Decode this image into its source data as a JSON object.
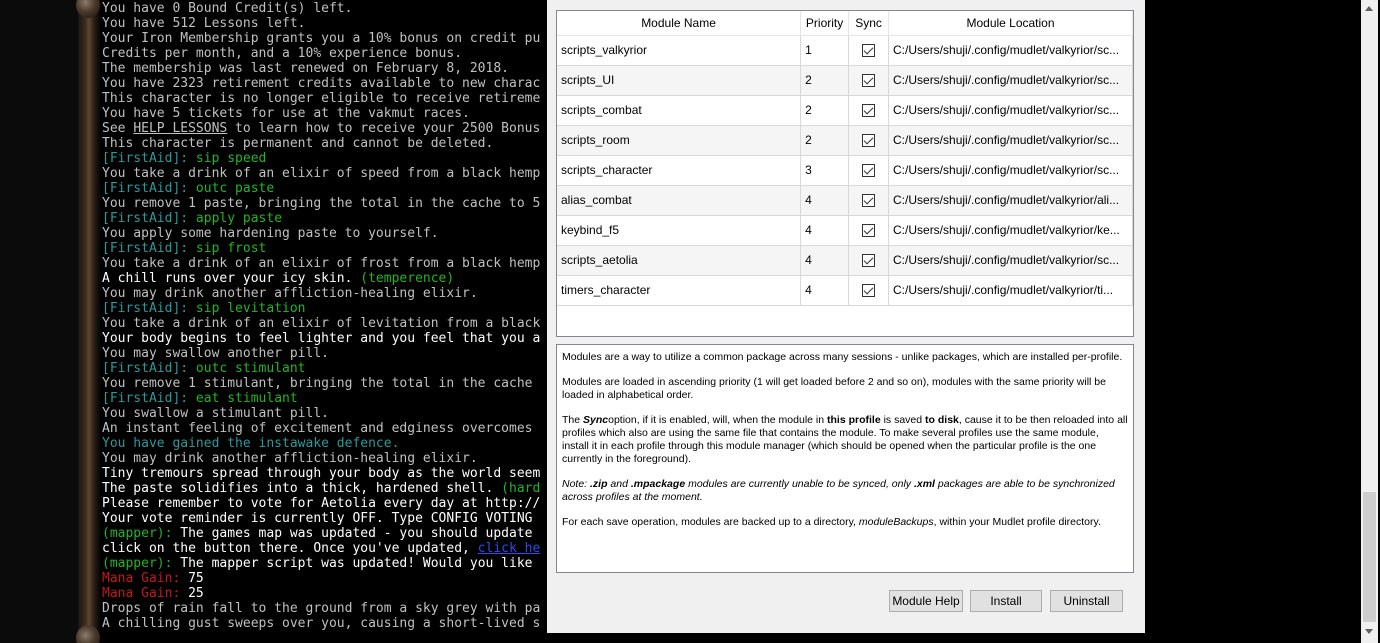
{
  "console": [
    [
      {
        "t": "You have 0 Bound Credit(s) left.",
        "c": "c-gray"
      }
    ],
    [
      {
        "t": "You have 512 Lessons left.",
        "c": "c-gray"
      }
    ],
    [
      {
        "t": "Your Iron Membership grants you a 10% bonus on credit pu",
        "c": "c-gray"
      }
    ],
    [
      {
        "t": "Credits per month, and a 10% experience bonus.",
        "c": "c-gray"
      }
    ],
    [
      {
        "t": "The membership was last renewed on February 8, 2018.",
        "c": "c-gray"
      }
    ],
    [
      {
        "t": "You have 2323 retirement credits available to new charac",
        "c": "c-gray"
      }
    ],
    [
      {
        "t": "This character is no longer eligible to receive retireme",
        "c": "c-gray"
      }
    ],
    [
      {
        "t": "You have 5 tickets for use at the vakmut races.",
        "c": "c-gray"
      }
    ],
    [
      {
        "t": "See ",
        "c": "c-gray"
      },
      {
        "t": "HELP LESSONS",
        "c": "c-gray u"
      },
      {
        "t": " to learn how to receive your 2500 Bonus",
        "c": "c-gray"
      }
    ],
    [
      {
        "t": "This character is permanent and cannot be deleted.",
        "c": "c-gray"
      }
    ],
    [
      {
        "t": "[FirstAid]: ",
        "c": "c-teal"
      },
      {
        "t": "sip speed",
        "c": "c-green"
      }
    ],
    [
      {
        "t": "You take a drink of an elixir of speed from a black hemp",
        "c": "c-gray"
      }
    ],
    [
      {
        "t": "[FirstAid]: ",
        "c": "c-teal"
      },
      {
        "t": "outc paste",
        "c": "c-green"
      }
    ],
    [
      {
        "t": "You remove 1 paste, bringing the total in the cache to 5",
        "c": "c-gray"
      }
    ],
    [
      {
        "t": "[FirstAid]: ",
        "c": "c-teal"
      },
      {
        "t": "apply paste",
        "c": "c-green"
      }
    ],
    [
      {
        "t": "You apply some hardening paste to yourself.",
        "c": "c-gray"
      }
    ],
    [
      {
        "t": "[FirstAid]: ",
        "c": "c-teal"
      },
      {
        "t": "sip frost",
        "c": "c-green"
      }
    ],
    [
      {
        "t": "You take a drink of an elixir of frost from a black hemp",
        "c": "c-gray"
      }
    ],
    [
      {
        "t": "A chill runs over your icy skin. ",
        "c": "c-white"
      },
      {
        "t": "(temperence)",
        "c": "c-green"
      }
    ],
    [
      {
        "t": "You may drink another affliction-healing elixir.",
        "c": "c-gray"
      }
    ],
    [
      {
        "t": "[FirstAid]: ",
        "c": "c-teal"
      },
      {
        "t": "sip levitation",
        "c": "c-green"
      }
    ],
    [
      {
        "t": "You take a drink of an elixir of levitation from a black",
        "c": "c-gray"
      }
    ],
    [
      {
        "t": "Your body begins to feel lighter and you feel that you a",
        "c": "c-white"
      }
    ],
    [
      {
        "t": "You may swallow another pill.",
        "c": "c-gray"
      }
    ],
    [
      {
        "t": "[FirstAid]: ",
        "c": "c-teal"
      },
      {
        "t": "outc stimulant",
        "c": "c-green"
      }
    ],
    [
      {
        "t": "You remove 1 stimulant, bringing the total in the cache",
        "c": "c-gray"
      }
    ],
    [
      {
        "t": "[FirstAid]: ",
        "c": "c-teal"
      },
      {
        "t": "eat stimulant",
        "c": "c-green"
      }
    ],
    [
      {
        "t": "You swallow a stimulant pill.",
        "c": "c-gray"
      }
    ],
    [
      {
        "t": "An instant feeling of excitement and edginess overcomes",
        "c": "c-gray"
      }
    ],
    [
      {
        "t": "You have gained the instawake defence.",
        "c": "c-teal"
      }
    ],
    [
      {
        "t": "You may drink another affliction-healing elixir.",
        "c": "c-gray"
      }
    ],
    [
      {
        "t": "Tiny tremours spread through your body as the world seem",
        "c": "c-white"
      }
    ],
    [
      {
        "t": "The paste solidifies into a thick, hardened shell. ",
        "c": "c-white"
      },
      {
        "t": "(hard",
        "c": "c-green"
      }
    ],
    [
      {
        "t": "Please remember to vote for Aetolia every day at http://",
        "c": "c-white"
      }
    ],
    [
      {
        "t": "Your vote reminder is currently OFF. Type CONFIG VOTING",
        "c": "c-white"
      }
    ],
    [
      {
        "t": "(mapper): ",
        "c": "c-green"
      },
      {
        "t": "The games map was updated - you should update",
        "c": "c-white"
      }
    ],
    [
      {
        "t": "click on the button there. Once you've updated, ",
        "c": "c-white"
      },
      {
        "t": "click he",
        "c": "c-link"
      }
    ],
    [
      {
        "t": "(mapper): ",
        "c": "c-green"
      },
      {
        "t": "The mapper script was updated! Would you like",
        "c": "c-white"
      }
    ],
    [
      {
        "t": "Mana Gain: ",
        "c": "c-red"
      },
      {
        "t": "75",
        "c": "c-white"
      }
    ],
    [
      {
        "t": "Mana Gain: ",
        "c": "c-red"
      },
      {
        "t": "25",
        "c": "c-white"
      }
    ],
    [
      {
        "t": "Drops of rain fall to the ground from a sky grey with pa",
        "c": "c-gray"
      }
    ],
    [
      {
        "t": "A chilling gust sweeps over you, causing a short-lived s",
        "c": "c-gray"
      }
    ]
  ],
  "module_table": {
    "headers": [
      "Module Name",
      "Priority",
      "Sync",
      "Module Location"
    ],
    "rows": [
      {
        "name": "scripts_valkyrior",
        "priority": "1",
        "location": "C:/Users/shuji/.config/mudlet/valkyrior/sc..."
      },
      {
        "name": "scripts_UI",
        "priority": "2",
        "location": "C:/Users/shuji/.config/mudlet/valkyrior/sc..."
      },
      {
        "name": "scripts_combat",
        "priority": "2",
        "location": "C:/Users/shuji/.config/mudlet/valkyrior/sc..."
      },
      {
        "name": "scripts_room",
        "priority": "2",
        "location": "C:/Users/shuji/.config/mudlet/valkyrior/sc..."
      },
      {
        "name": "scripts_character",
        "priority": "3",
        "location": "C:/Users/shuji/.config/mudlet/valkyrior/sc..."
      },
      {
        "name": "alias_combat",
        "priority": "4",
        "location": "C:/Users/shuji/.config/mudlet/valkyrior/ali..."
      },
      {
        "name": "keybind_f5",
        "priority": "4",
        "location": "C:/Users/shuji/.config/mudlet/valkyrior/ke..."
      },
      {
        "name": "scripts_aetolia",
        "priority": "4",
        "location": "C:/Users/shuji/.config/mudlet/valkyrior/sc..."
      },
      {
        "name": "timers_character",
        "priority": "4",
        "location": "C:/Users/shuji/.config/mudlet/valkyrior/ti..."
      }
    ]
  },
  "help": {
    "p1": "Modules are a way to utilize a common package across many sessions - unlike packages, which are installed per-profile.",
    "p2": "Modules are loaded in ascending priority (1 will get loaded before 2 and so on), modules with the same priority will be loaded in alphabetical order.",
    "p3": {
      "a": "The ",
      "b": "Sync",
      "c": "option, if it is enabled, will, when the module in ",
      "d": "this profile",
      "e": " is saved ",
      "f": "to disk",
      "g": ", cause it to be then reloaded into all profiles which also are using the same file that contains the module. To make several profiles use the same module, install it in each profile through this module manager (which should be opened when the particular profile is the one currently in the foreground)."
    },
    "p4": {
      "a": "Note: ",
      "b": ".zip",
      "c": " and ",
      "d": ".mpackage",
      "e": " modules are currently unable to be synced, only ",
      "f": ".xml",
      "g": " packages are able to be synchronized across profiles at the moment."
    },
    "p5": {
      "a": "For each save operation, modules are backed up to a directory, ",
      "b": "moduleBackups",
      "c": ", within your Mudlet profile directory."
    }
  },
  "buttons": {
    "module_help": "Module Help",
    "install": "Install",
    "uninstall": "Uninstall"
  }
}
